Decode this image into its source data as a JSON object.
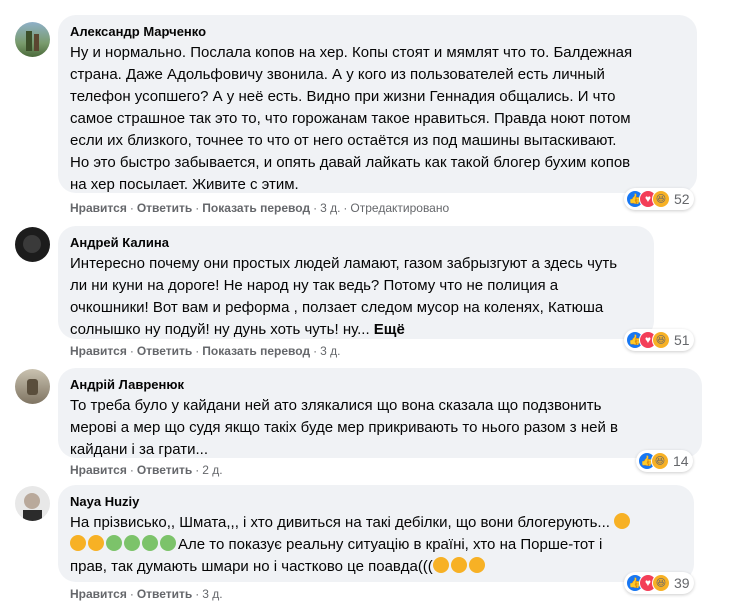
{
  "comments": [
    {
      "author": "Александр Марченко",
      "text": "Ну и нормально. Послала копов на хер. Копы стоят и мямлят что то. Балдежная\nстрана. Даже Адольфовичу звонила. А у кого из пользователей есть личный\nтелефон усопшего? А у неё есть. Видно при жизни Геннадия общались. И что\nсамое страшное так это то, что горожанам такое нравиться. Правда ноют потом\nесли их близкого, точнее то что от него остаётся из под машины вытаскивают.\nНо это быстро забывается, и опять давай лайкать как такой блогер бухим копов\nна хер посылает. Живите с этим.",
      "like": "Нравится",
      "reply": "Ответить",
      "translate": "Показать перевод",
      "time": "3 д.",
      "edited": "Отредактировано",
      "reaction_count": "52",
      "reactions": [
        "like-icon",
        "love-icon",
        "haha-icon"
      ]
    },
    {
      "author": "Андрей Калина",
      "text": "Интересно почему они простых людей ламают, газом забрызгуют а здесь чуть\nли ни куни на дороге! Не народ ну так ведь? Потому что не полиция а\nочкошники! Вот вам и реформа , ползает следом мусор на коленях, Катюша\nсолнышко ну подуй! ну дунь хоть чуть! ну...",
      "more": "Ещё",
      "like": "Нравится",
      "reply": "Ответить",
      "translate": "Показать перевод",
      "time": "3 д.",
      "reaction_count": "51",
      "reactions": [
        "like-icon",
        "love-icon",
        "haha-icon"
      ]
    },
    {
      "author": "Андрій Лавренюк",
      "text": "То треба було у кайдани ней ато злякалися що вона сказала що подзвонить\nмерові а мер що судя якщо такіх буде мер прикривають то нього разом з ней в\nкайдани і за грати...",
      "like": "Нравится",
      "reply": "Ответить",
      "time": "2 д.",
      "reaction_count": "14",
      "reactions": [
        "like-icon",
        "haha-icon"
      ]
    },
    {
      "author": "Naya Huziy",
      "text_line1": "На прізвисько,, Шмата,,, і хто дивиться на такі дебілки, що вони блогерують...",
      "text_line2": "Але то показує реальну ситуацію в країні, хто на Порше-тот і",
      "text_line3": "прав, так думають шмари но і частково це поавда(((",
      "like": "Нравится",
      "reply": "Ответить",
      "time": "3 д.",
      "reaction_count": "39",
      "reactions": [
        "like-icon",
        "love-icon",
        "haha-icon"
      ]
    }
  ],
  "colors": {
    "bubble": "#f0f2f5",
    "meta": "#65676b",
    "like": "#1877f2"
  }
}
